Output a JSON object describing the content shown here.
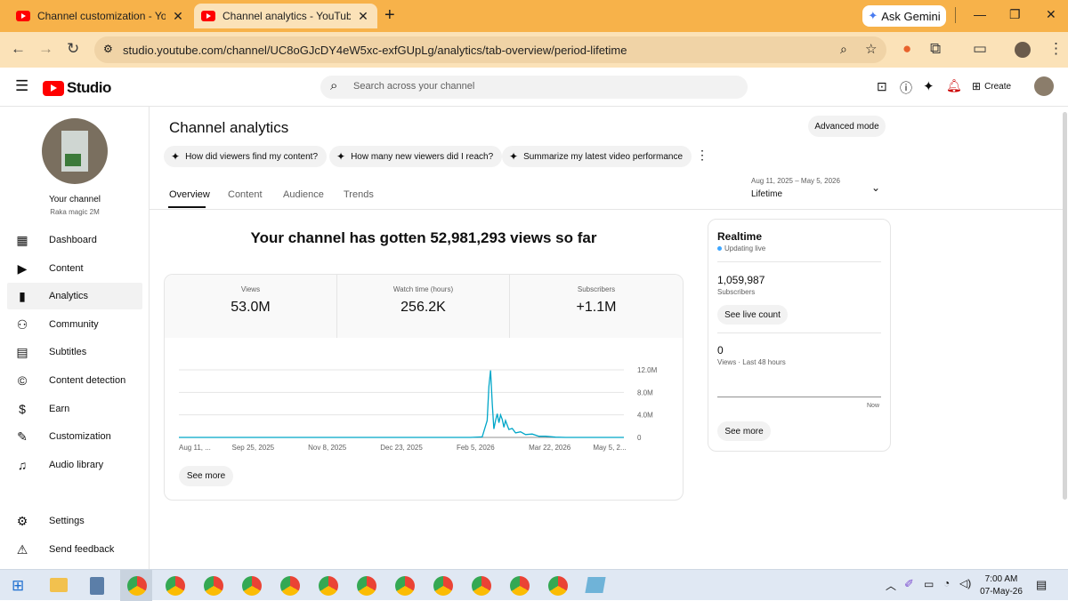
{
  "browser": {
    "tabs": [
      {
        "title": "Channel customization - YouTu"
      },
      {
        "title": "Channel analytics - YouTube St"
      }
    ],
    "new_tab_symbol": "+",
    "ask_gemini": "Ask Gemini",
    "url": "studio.youtube.com/channel/UC8oGJcDY4eW5xc-exfGUpLg/analytics/tab-overview/period-lifetime"
  },
  "studio": {
    "logo_text": "Studio",
    "search_placeholder": "Search across your channel",
    "create_label": "Create"
  },
  "sidebar": {
    "channel_label": "Your channel",
    "channel_name": "Raka magic 2M",
    "items": [
      {
        "label": "Dashboard",
        "icon": "dashboard-icon"
      },
      {
        "label": "Content",
        "icon": "content-icon"
      },
      {
        "label": "Analytics",
        "icon": "analytics-icon"
      },
      {
        "label": "Community",
        "icon": "community-icon"
      },
      {
        "label": "Subtitles",
        "icon": "subtitles-icon"
      },
      {
        "label": "Content detection",
        "icon": "copyright-icon"
      },
      {
        "label": "Earn",
        "icon": "earn-icon"
      },
      {
        "label": "Customization",
        "icon": "customization-icon"
      },
      {
        "label": "Audio library",
        "icon": "audio-library-icon"
      }
    ],
    "settings": "Settings",
    "feedback": "Send feedback"
  },
  "main": {
    "title": "Channel analytics",
    "advanced_mode": "Advanced mode",
    "chips": [
      "How did viewers find my content?",
      "How many new viewers did I reach?",
      "Summarize my latest video performance"
    ],
    "tabs": [
      "Overview",
      "Content",
      "Audience",
      "Trends"
    ],
    "date_range": "Aug 11, 2025 – May 5, 2026",
    "period": "Lifetime",
    "headline": "Your channel has gotten 52,981,293 views so far",
    "metrics": [
      {
        "label": "Views",
        "value": "53.0M"
      },
      {
        "label": "Watch time (hours)",
        "value": "256.2K"
      },
      {
        "label": "Subscribers",
        "value": "+1.1M"
      }
    ],
    "see_more": "See more"
  },
  "realtime": {
    "title": "Realtime",
    "status": "Updating live",
    "subs_value": "1,059,987",
    "subs_label": "Subscribers",
    "see_live": "See live count",
    "views_value": "0",
    "views_label": "Views · Last 48 hours",
    "now_label": "Now",
    "see_more": "See more"
  },
  "chart_data": {
    "type": "line",
    "x_ticks": [
      "Aug 11, ...",
      "Sep 25, 2025",
      "Nov 8, 2025",
      "Dec 23, 2025",
      "Feb 5, 2026",
      "Mar 22, 2026",
      "May 5, 2..."
    ],
    "y_ticks": [
      "12.0M",
      "8.0M",
      "4.0M",
      "0"
    ],
    "ylim": [
      0,
      12000000
    ],
    "series": [
      {
        "values": [
          [
            0,
            0
          ],
          [
            100,
            0
          ],
          [
            150,
            0
          ],
          [
            175,
            0
          ],
          [
            182,
            0.1
          ],
          [
            185,
            3
          ],
          [
            186,
            9
          ],
          [
            187,
            11.9
          ],
          [
            188,
            6
          ],
          [
            189,
            1.5
          ],
          [
            190,
            3
          ],
          [
            191,
            4.2
          ],
          [
            192,
            2.6
          ],
          [
            193,
            4
          ],
          [
            194,
            3.2
          ],
          [
            195,
            1.8
          ],
          [
            196,
            3
          ],
          [
            197,
            2.2
          ],
          [
            198,
            1.4
          ],
          [
            200,
            1.6
          ],
          [
            202,
            0.8
          ],
          [
            205,
            1
          ],
          [
            208,
            0.5
          ],
          [
            212,
            0.6
          ],
          [
            216,
            0.2
          ],
          [
            220,
            0.2
          ],
          [
            226,
            0.05
          ],
          [
            232,
            0
          ],
          [
            267,
            0
          ]
        ]
      }
    ],
    "x_domain": [
      0,
      267
    ],
    "color": "#00a6c8"
  },
  "taskbar": {
    "time": "7:00 AM",
    "date": "07-May-26"
  }
}
